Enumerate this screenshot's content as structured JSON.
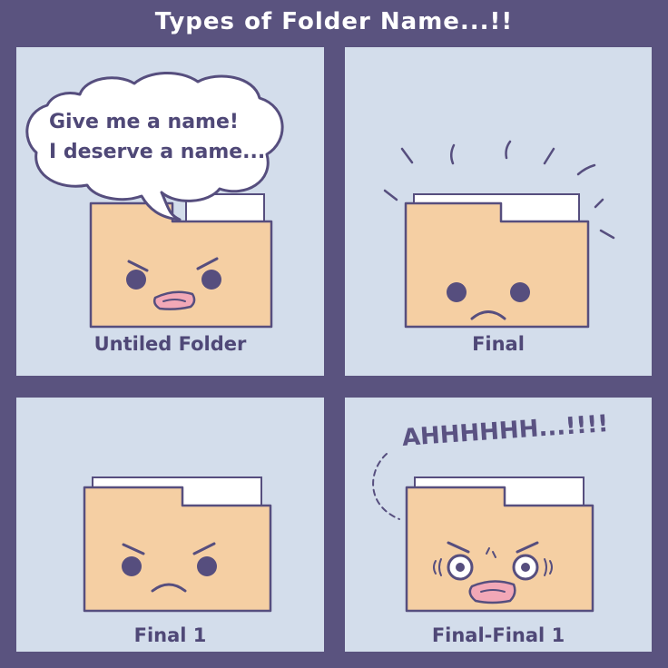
{
  "title": "Types of Folder Name...!!",
  "colors": {
    "background": "#5a537f",
    "panel": "#d3ddeb",
    "folder": "#f5cfa3",
    "outline": "#564e7e",
    "tongue": "#f2a8b7"
  },
  "panels": [
    {
      "caption": "Untiled Folder",
      "speech_lines": [
        "Give me a name!",
        "I deserve a name..."
      ],
      "mood": "annoyed",
      "icon": "folder-face-icon"
    },
    {
      "caption": "Final",
      "mood": "sad",
      "icon": "folder-face-icon"
    },
    {
      "caption": "Final 1",
      "mood": "angry",
      "icon": "folder-face-icon"
    },
    {
      "caption": "Final-Final 1",
      "shout": "AHHHHHH...!!!!",
      "mood": "furious",
      "icon": "folder-face-icon"
    }
  ]
}
